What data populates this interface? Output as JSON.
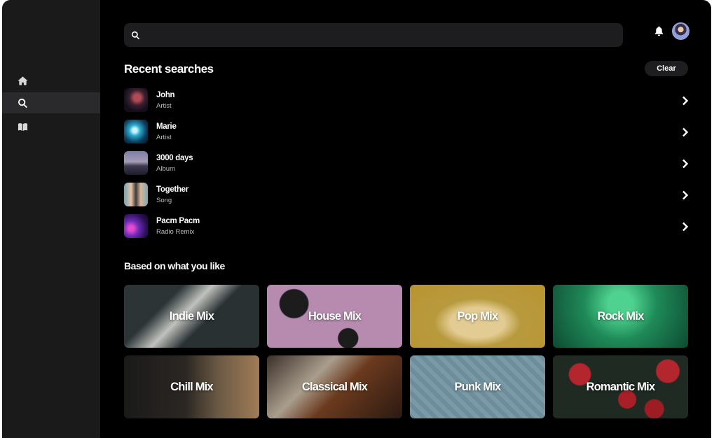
{
  "search": {
    "placeholder": ""
  },
  "sidebar": {
    "items": [
      {
        "icon": "home-icon"
      },
      {
        "icon": "search-icon",
        "active": true
      },
      {
        "icon": "library-icon"
      }
    ]
  },
  "header": {
    "icons": [
      "bell-icon",
      "avatar"
    ]
  },
  "recent": {
    "title": "Recent searches",
    "clear_label": "Clear",
    "items": [
      {
        "name": "John",
        "type": "Artist"
      },
      {
        "name": "Marie",
        "type": "Artist"
      },
      {
        "name": "3000 days",
        "type": "Album"
      },
      {
        "name": "Together",
        "type": "Song"
      },
      {
        "name": "Pacm Pacm",
        "type": "Radio Remix"
      }
    ]
  },
  "based": {
    "title": "Based on what you like",
    "mixes": [
      {
        "label": "Indie Mix"
      },
      {
        "label": "House Mix"
      },
      {
        "label": "Pop Mix"
      },
      {
        "label": "Rock Mix"
      },
      {
        "label": "Chill Mix"
      },
      {
        "label": "Classical Mix"
      },
      {
        "label": "Punk Mix"
      },
      {
        "label": "Romantic Mix"
      }
    ]
  }
}
